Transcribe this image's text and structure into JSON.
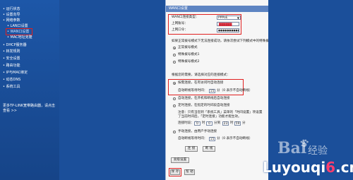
{
  "sidebar": {
    "items": [
      {
        "label": "• 运行状态",
        "sub": false
      },
      {
        "label": "• 设置向导",
        "sub": false
      },
      {
        "label": "• 网络参数",
        "sub": false
      },
      {
        "label": "• LAN口设置",
        "sub": true
      },
      {
        "label": "• WAN口设置",
        "sub": true
      },
      {
        "label": "• MAC地址克隆",
        "sub": true
      },
      {
        "label": "• DHCP服务器",
        "sub": false
      },
      {
        "label": "• 转发规则",
        "sub": false
      },
      {
        "label": "• 安全设置",
        "sub": false
      },
      {
        "label": "• 路由功能",
        "sub": false
      },
      {
        "label": "• IP与MAC绑定",
        "sub": false
      },
      {
        "label": "• 动态DNS",
        "sub": false
      },
      {
        "label": "• 系统工具",
        "sub": false
      }
    ],
    "footer": "更多TP-LINK宽带路由器，请点击查看 >>"
  },
  "panel": {
    "title": "WAN口设置",
    "conn_type_label": "WAN口连接类型：",
    "conn_type_value": "PPPoE",
    "account_label": "上网账号：",
    "account_value": "██████",
    "password_label": "上网口令：",
    "password_value": "●●●●●●●●●●●●",
    "special_intro": "如果正常拨号模式下无法连接成功，请依次尝试下列模式中的特殊拨号模式：",
    "dial_normal": "正常拨号模式",
    "dial_special1": "特殊拨号模式1",
    "dial_special2": "特殊拨号模式2",
    "mode_intro": "根据您的需要，请选择对应的连接模式：",
    "mode_ondemand": "按需连接，在有访问时自动连接",
    "auto_disconnect_label": "自动断线等待时间：",
    "auto_disconnect_value": "15",
    "auto_disconnect_unit": "分（0 表示不自动断线）",
    "mode_auto": "自动连接，在开机和断线后自动连接",
    "mode_timed": "定时连接，在指定的时间段自动连接",
    "timed_note": "注意：只有当您到「系统工具」菜单的「时间设置」项设置了当前时间后，「定时连接」功能才能生效。",
    "timed_range_prefix": "连接时段：从",
    "timed_h1": "0",
    "timed_hour1": "时",
    "timed_m1": "0",
    "timed_min1": "分到",
    "timed_h2": "23",
    "timed_hour2": "时",
    "timed_m2": "59",
    "timed_min2": "分",
    "mode_manual": "手动连接，由用户手动连接",
    "manual_wait_value": "15",
    "btn_connect": "连 接",
    "btn_disconnect": "断 线",
    "btn_advanced": "高级设置",
    "btn_save": "保 存",
    "btn_help": "帮 助"
  },
  "watermark": {
    "baidu": "Bai",
    "jingyan": "经验",
    "site_a": "Luyouqi",
    "site_num": "6",
    "site_b": ".cn"
  },
  "colors": {
    "background": "#1b4f9a",
    "panel_title": "#5d84c2",
    "highlight_box": "#e02020"
  }
}
